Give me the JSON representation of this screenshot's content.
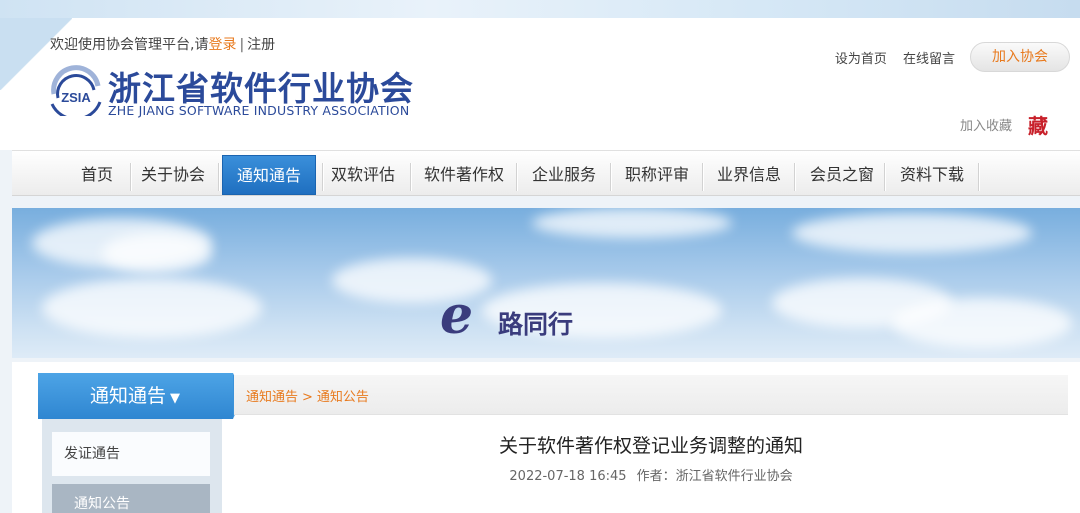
{
  "header": {
    "welcome_text": "欢迎使用协会管理平台,请",
    "login_label": "登录",
    "separator": "|",
    "register_label": "注册",
    "logo_text": "ZSIA",
    "org_name_cn": "浙江省软件行业协会",
    "org_name_en": "ZHE JIANG SOFTWARE INDUSTRY ASSOCIATION",
    "set_home_label": "设为首页",
    "message_label": "在线留言",
    "join_label": "加入协会",
    "favorite_label": "加入收藏",
    "favorite_icon_char": "藏"
  },
  "nav": {
    "items": [
      "首页",
      "关于协会",
      "通知通告",
      "双软评估",
      "软件著作权",
      "企业服务",
      "职称评审",
      "业界信息",
      "会员之窗",
      "资料下载"
    ],
    "active_index": 2
  },
  "banner": {
    "slogan_e": "e",
    "slogan_text": "路同行"
  },
  "sidebar": {
    "title": "通知通告",
    "caret": "▼",
    "items": [
      "发证通告",
      "通知公告"
    ]
  },
  "breadcrumb": {
    "first": "通知通告",
    "sep": ">",
    "second": "通知公告"
  },
  "article": {
    "title": "关于软件著作权登记业务调整的通知",
    "datetime": "2022-07-18 16:45",
    "author_label": "作者：",
    "author": "浙江省软件行业协会"
  },
  "colors": {
    "accent_orange": "#e87a1e",
    "nav_active_blue": "#1f6fc0",
    "brand_blue": "#2b4a9a"
  }
}
